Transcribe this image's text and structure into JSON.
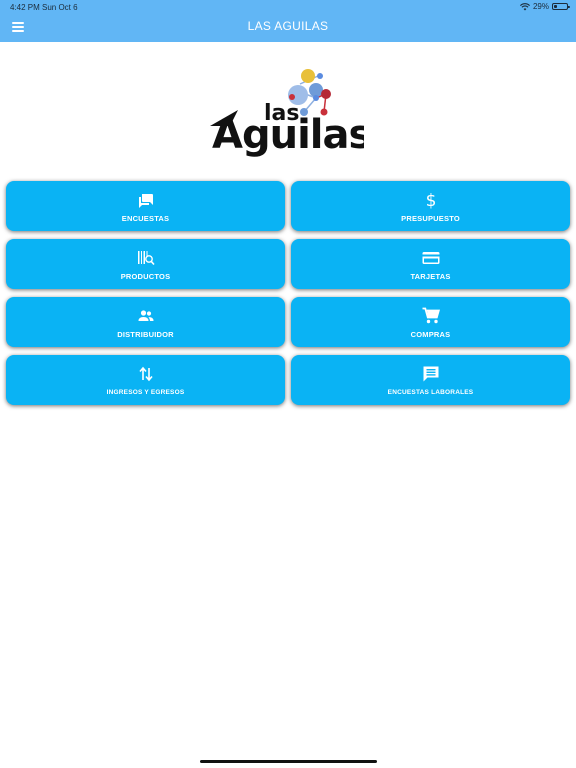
{
  "status_bar": {
    "time": "4:42 PM",
    "date": "Sun Oct 6",
    "battery_text": "29%",
    "battery_level": 0.29
  },
  "app_bar": {
    "title": "LAS AGUILAS",
    "menu_icon": "hamburger-menu-icon",
    "background": "#61b6f5"
  },
  "logo": {
    "line1": "las",
    "line2": "Aguilas"
  },
  "tiles": [
    {
      "label": "ENCUESTAS",
      "icon": "chat-bubbles-icon"
    },
    {
      "label": "PRESUPUESTO",
      "icon": "dollar-icon"
    },
    {
      "label": "PRODUCTOS",
      "icon": "barcode-search-icon"
    },
    {
      "label": "TARJETAS",
      "icon": "credit-card-icon"
    },
    {
      "label": "DISTRIBUIDOR",
      "icon": "people-icon"
    },
    {
      "label": "COMPRAS",
      "icon": "shopping-cart-icon"
    },
    {
      "label": "INGRESOS Y EGRESOS",
      "icon": "swap-vertical-icon"
    },
    {
      "label": "ENCUESTAS LABORALES",
      "icon": "message-list-icon"
    }
  ],
  "colors": {
    "tile": "#0ab3f4",
    "tile_text": "#ffffff"
  }
}
